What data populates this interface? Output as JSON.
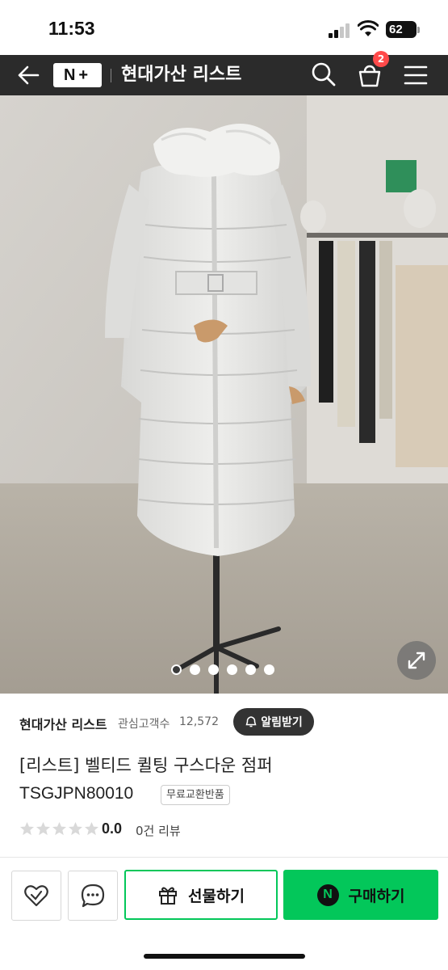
{
  "status_bar": {
    "time": "11:53",
    "battery": "62"
  },
  "header": {
    "logo_text": "N+",
    "store_title": "현대가산 리스트",
    "cart_count": "2"
  },
  "gallery": {
    "image_count": 6,
    "active_index": 0,
    "description_icon": "expand-icon"
  },
  "store": {
    "name": "현대가산 리스트",
    "followers_label": "관심고객수",
    "followers_count": "12,572",
    "alarm_label": "알림받기"
  },
  "product": {
    "title_line1": "[리스트] 벨티드 퀼팅 구스다운 점퍼",
    "title_line2": "TSGJPN80010",
    "tag": "무료교환반품",
    "rating": "0.0",
    "stars_filled": 0,
    "review_text": "0건 리뷰"
  },
  "actions": {
    "gift_label": "선물하기",
    "buy_label": "구매하기",
    "buy_badge": "N"
  },
  "colors": {
    "header_bg": "#2b2b2b",
    "naver_green": "#03c75a",
    "badge_red": "#ff4a4a"
  }
}
